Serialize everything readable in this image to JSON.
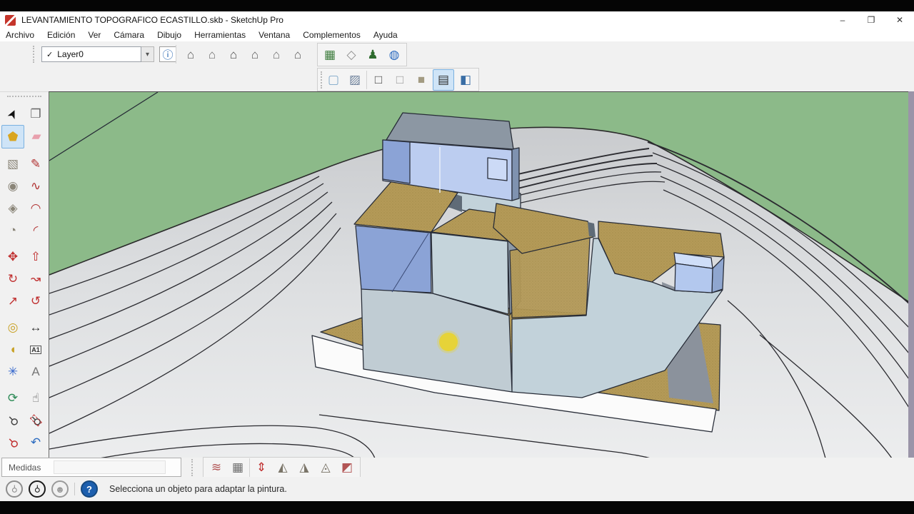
{
  "window": {
    "title": "LEVANTAMIENTO TOPOGRAFICO ECASTILLO.skb - SketchUp Pro",
    "controls": [
      {
        "name": "minimize-button",
        "glyph": "–"
      },
      {
        "name": "restore-button",
        "glyph": "❐"
      },
      {
        "name": "close-button",
        "glyph": "✕"
      }
    ]
  },
  "menu": {
    "items": [
      "Archivo",
      "Edición",
      "Ver",
      "Cámara",
      "Dibujo",
      "Herramientas",
      "Ventana",
      "Complementos",
      "Ayuda"
    ]
  },
  "toolbars": {
    "layers": {
      "checkmark": "✓",
      "field_value": "Layer0",
      "dropdown_glyph": "▾",
      "manager": {
        "name": "layer-manager",
        "glyph": "ⓘ"
      }
    },
    "views": {
      "items": [
        {
          "name": "iso-view",
          "glyph": "⌂",
          "color": "#5a5a5a"
        },
        {
          "name": "top-view",
          "glyph": "⌂",
          "color": "#6e6e6e"
        },
        {
          "name": "front-view",
          "glyph": "⌂",
          "color": "#4a4a4a"
        },
        {
          "name": "right-view",
          "glyph": "⌂",
          "color": "#5a5a5a"
        },
        {
          "name": "back-view",
          "glyph": "⌂",
          "color": "#6e6e6e"
        },
        {
          "name": "left-view",
          "glyph": "⌂",
          "color": "#5a5a5a"
        }
      ]
    },
    "geo": {
      "items": [
        {
          "name": "add-location",
          "glyph": "▦",
          "color": "#3f7d3f"
        },
        {
          "name": "toggle-terrain",
          "glyph": "◇",
          "color": "#8e8e8e"
        },
        {
          "name": "photo-textures",
          "glyph": "♟",
          "color": "#2e6b2e"
        },
        {
          "name": "google-earth",
          "glyph": "◍",
          "color": "#2d6cc0"
        }
      ]
    },
    "styles": {
      "items": [
        {
          "name": "x-ray",
          "glyph": "▢",
          "color": "#7fa8c9"
        },
        {
          "name": "back-edges",
          "glyph": "▨",
          "color": "#6b7f99",
          "sep_after": true
        },
        {
          "name": "wireframe",
          "glyph": "□",
          "color": "#444444"
        },
        {
          "name": "hidden-line",
          "glyph": "□",
          "color": "#999999"
        },
        {
          "name": "shaded",
          "glyph": "■",
          "color": "#a39b82"
        },
        {
          "name": "shaded-with-textures",
          "glyph": "▤",
          "color": "#2f2f2f",
          "selected": true
        },
        {
          "name": "monochrome",
          "glyph": "◧",
          "color": "#3a6ea5"
        }
      ]
    },
    "left_tools": {
      "rows": [
        {
          "gap": false,
          "cells": [
            {
              "name": "select",
              "glyph": "➤",
              "color": "#111111",
              "cls": "rA"
            },
            {
              "name": "make-component",
              "glyph": "❐",
              "color": "#666666"
            }
          ]
        },
        {
          "gap": false,
          "cells": [
            {
              "name": "paint-bucket",
              "glyph": "⬟",
              "color": "#d9a520",
              "selected": true
            },
            {
              "name": "eraser",
              "glyph": "▰",
              "color": "#e8a0ad"
            }
          ]
        },
        {
          "gap": true,
          "cells": [
            {
              "name": "rectangle",
              "glyph": "▧",
              "color": "#8a8578"
            },
            {
              "name": "line",
              "glyph": "✎",
              "color": "#b03030"
            }
          ]
        },
        {
          "gap": false,
          "cells": [
            {
              "name": "circle",
              "glyph": "◉",
              "color": "#8a8578"
            },
            {
              "name": "freehand",
              "glyph": "∿",
              "color": "#b03030"
            }
          ]
        },
        {
          "gap": false,
          "cells": [
            {
              "name": "polygon",
              "glyph": "◈",
              "color": "#8a8578"
            },
            {
              "name": "arc",
              "glyph": "◠",
              "color": "#b03030"
            }
          ]
        },
        {
          "gap": false,
          "cells": [
            {
              "name": "pie",
              "glyph": "◔",
              "color": "#8a8578"
            },
            {
              "name": "two-point-arc",
              "glyph": "◜",
              "color": "#b03030"
            }
          ]
        },
        {
          "gap": true,
          "cells": [
            {
              "name": "move",
              "glyph": "✥",
              "color": "#c03030"
            },
            {
              "name": "push-pull",
              "glyph": "⇧",
              "color": "#c03030"
            }
          ]
        },
        {
          "gap": false,
          "cells": [
            {
              "name": "rotate",
              "glyph": "↻",
              "color": "#c03030"
            },
            {
              "name": "follow-me",
              "glyph": "↝",
              "color": "#c03030"
            }
          ]
        },
        {
          "gap": false,
          "cells": [
            {
              "name": "scale",
              "glyph": "↗",
              "color": "#c03030"
            },
            {
              "name": "offset",
              "glyph": "↺",
              "color": "#c03030"
            }
          ]
        },
        {
          "gap": true,
          "cells": [
            {
              "name": "tape-measure",
              "glyph": "◎",
              "color": "#c9a227"
            },
            {
              "name": "dimensions",
              "glyph": "↔",
              "color": "#333333"
            }
          ]
        },
        {
          "gap": false,
          "cells": [
            {
              "name": "protractor",
              "glyph": "◖",
              "color": "#c9a227"
            },
            {
              "name": "text",
              "glyph": "A1",
              "color": "#333333",
              "cls": "boxed"
            }
          ]
        },
        {
          "gap": false,
          "cells": [
            {
              "name": "axes",
              "glyph": "✳",
              "color": "#3366cc"
            },
            {
              "name": "3d-text",
              "glyph": "A",
              "color": "#777777"
            }
          ]
        },
        {
          "gap": true,
          "cells": [
            {
              "name": "orbit",
              "glyph": "⟳",
              "color": "#2e8b57"
            },
            {
              "name": "pan",
              "glyph": "☝",
              "color": "#555555"
            }
          ]
        },
        {
          "gap": false,
          "cells": [
            {
              "name": "zoom",
              "glyph": "⚲",
              "color": "#444444",
              "cls": "rB"
            },
            {
              "name": "zoom-window",
              "glyph": "⚲",
              "color": "#444444",
              "cls": "rB dashedred"
            }
          ]
        },
        {
          "gap": false,
          "cells": [
            {
              "name": "zoom-extents",
              "glyph": "⚲",
              "color": "#c03030",
              "cls": "rB"
            },
            {
              "name": "previous-view",
              "glyph": "↶",
              "color": "#2d6cc0"
            }
          ]
        }
      ]
    },
    "sandbox": {
      "items": [
        {
          "name": "from-contours",
          "glyph": "≋",
          "color": "#b25555"
        },
        {
          "name": "from-scratch",
          "glyph": "▦",
          "color": "#6e6e6e",
          "sep_after": true
        },
        {
          "name": "smoove",
          "glyph": "⇕",
          "color": "#c03030"
        },
        {
          "name": "stamp",
          "glyph": "◭",
          "color": "#7a7468"
        },
        {
          "name": "drape",
          "glyph": "◮",
          "color": "#7a7468"
        },
        {
          "name": "add-detail",
          "glyph": "◬",
          "color": "#7a7468"
        },
        {
          "name": "flip-edge",
          "glyph": "◩",
          "color": "#b25555"
        }
      ]
    }
  },
  "measurements": {
    "label": "Medidas",
    "value": ""
  },
  "status_bar": {
    "icons": [
      {
        "name": "geolocation",
        "glyph": "⚲",
        "cls": "outline1 rC"
      },
      {
        "name": "model-location",
        "glyph": "⚲",
        "cls": "outline2 rC"
      },
      {
        "name": "claim-credit",
        "glyph": "☻",
        "cls": "outline3"
      },
      {
        "name": "help",
        "glyph": "?",
        "cls": "help"
      }
    ],
    "message": "Selecciona un objeto para adaptar la pintura."
  },
  "viewport": {
    "colors": {
      "background_green": "#8cba89",
      "axis_green": "#4f9e4f",
      "terrain_gray": "#dcdee0",
      "contour_line": "#2b2b30",
      "roof_tan": "#b49a58",
      "wall_cornflower": "#8ba3d6",
      "wall_light_blue": "#bccdf0",
      "wall_pale_steel": "#c2d2da",
      "wall_shadow": "#8d9aa8",
      "roof_gray": "#8c97a3",
      "platform_white": "#fbfbfb",
      "cursor_highlight_yellow": "#e8d42f",
      "edge_strip": "#9a94a8"
    }
  }
}
